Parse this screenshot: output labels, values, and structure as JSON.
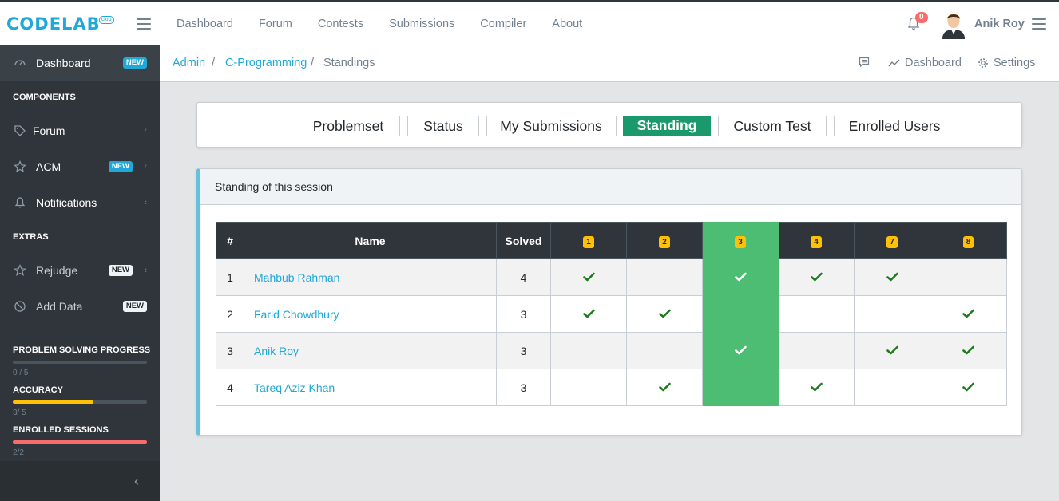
{
  "brand": {
    "logo": "CODELAB",
    "logo_sub": "club"
  },
  "topnav": [
    "Dashboard",
    "Forum",
    "Contests",
    "Submissions",
    "Compiler",
    "About"
  ],
  "user": {
    "name": "Anik Roy",
    "notifications": "0"
  },
  "sidebar": {
    "items": [
      {
        "label": "Dashboard",
        "badge": "NEW",
        "icon": "speedometer-icon"
      },
      {
        "label": "Forum",
        "icon": "tag-icon"
      },
      {
        "label": "ACM",
        "badge": "NEW",
        "icon": "star-icon"
      },
      {
        "label": "Notifications",
        "icon": "bell-icon"
      },
      {
        "label": "Rejudge",
        "badge": "NEW",
        "icon": "star-icon"
      },
      {
        "label": "Add Data",
        "badge": "NEW",
        "icon": "ban-icon"
      }
    ],
    "titles": {
      "components": "COMPONENTS",
      "extras": "EXTRAS"
    },
    "progress": [
      {
        "title": "PROBLEM SOLVING PROGRESS",
        "text": "0 / 5",
        "value": 0,
        "color": "#4b555d"
      },
      {
        "title": "ACCURACY",
        "text": "3/ 5",
        "value": 0.6,
        "color": "#ffc107"
      },
      {
        "title": "ENROLLED SESSIONS",
        "text": "2/2",
        "value": 1.0,
        "color": "#f86c6b"
      }
    ]
  },
  "breadcrumb": {
    "items": [
      "Admin",
      "C-Programming",
      "Standings"
    ],
    "sep": "/"
  },
  "bc_menu": {
    "dashboard": "Dashboard",
    "settings": "Settings"
  },
  "tabs": [
    "Problemset",
    "Status",
    "My Submissions",
    "Standing",
    "Custom Test",
    "Enrolled Users"
  ],
  "standings": {
    "title": "Standing of this session",
    "headers": {
      "rank": "#",
      "name": "Name",
      "solved": "Solved"
    },
    "problems": [
      "1",
      "2",
      "3",
      "4",
      "7",
      "8"
    ],
    "highlight_problem": "3",
    "rows": [
      {
        "rank": "1",
        "name": "Mahbub Rahman",
        "solved": "4",
        "cells": [
          true,
          false,
          true,
          true,
          true,
          false
        ]
      },
      {
        "rank": "2",
        "name": "Farid Chowdhury",
        "solved": "3",
        "cells": [
          true,
          true,
          false,
          false,
          false,
          true
        ]
      },
      {
        "rank": "3",
        "name": "Anik Roy",
        "solved": "3",
        "cells": [
          false,
          false,
          true,
          false,
          true,
          true
        ]
      },
      {
        "rank": "4",
        "name": "Tareq Aziz Khan",
        "solved": "3",
        "cells": [
          false,
          true,
          false,
          true,
          false,
          true
        ]
      }
    ]
  },
  "colors": {
    "accent": "#20a8d8",
    "success": "#4dbd74",
    "tab_active": "#1a9a6c",
    "sidebar": "#2f353a"
  }
}
